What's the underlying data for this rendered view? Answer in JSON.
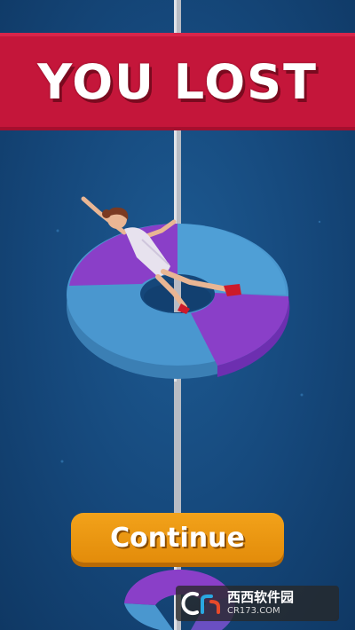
{
  "banner": {
    "title": "YOU LOST"
  },
  "buttons": {
    "continue_label": "Continue"
  },
  "watermark": {
    "logo_text": "CR",
    "site_name": "西西软件园",
    "site_url": "CR173.COM"
  },
  "colors": {
    "background": "#15477a",
    "banner": "#c4163a",
    "button": "#f2a21a",
    "ring_blue": "#4a97cf",
    "ring_purple": "#8a3fc8",
    "pole": "#b8bcc4"
  },
  "icons": {
    "watermark_logo": "cr-logo-icon"
  }
}
